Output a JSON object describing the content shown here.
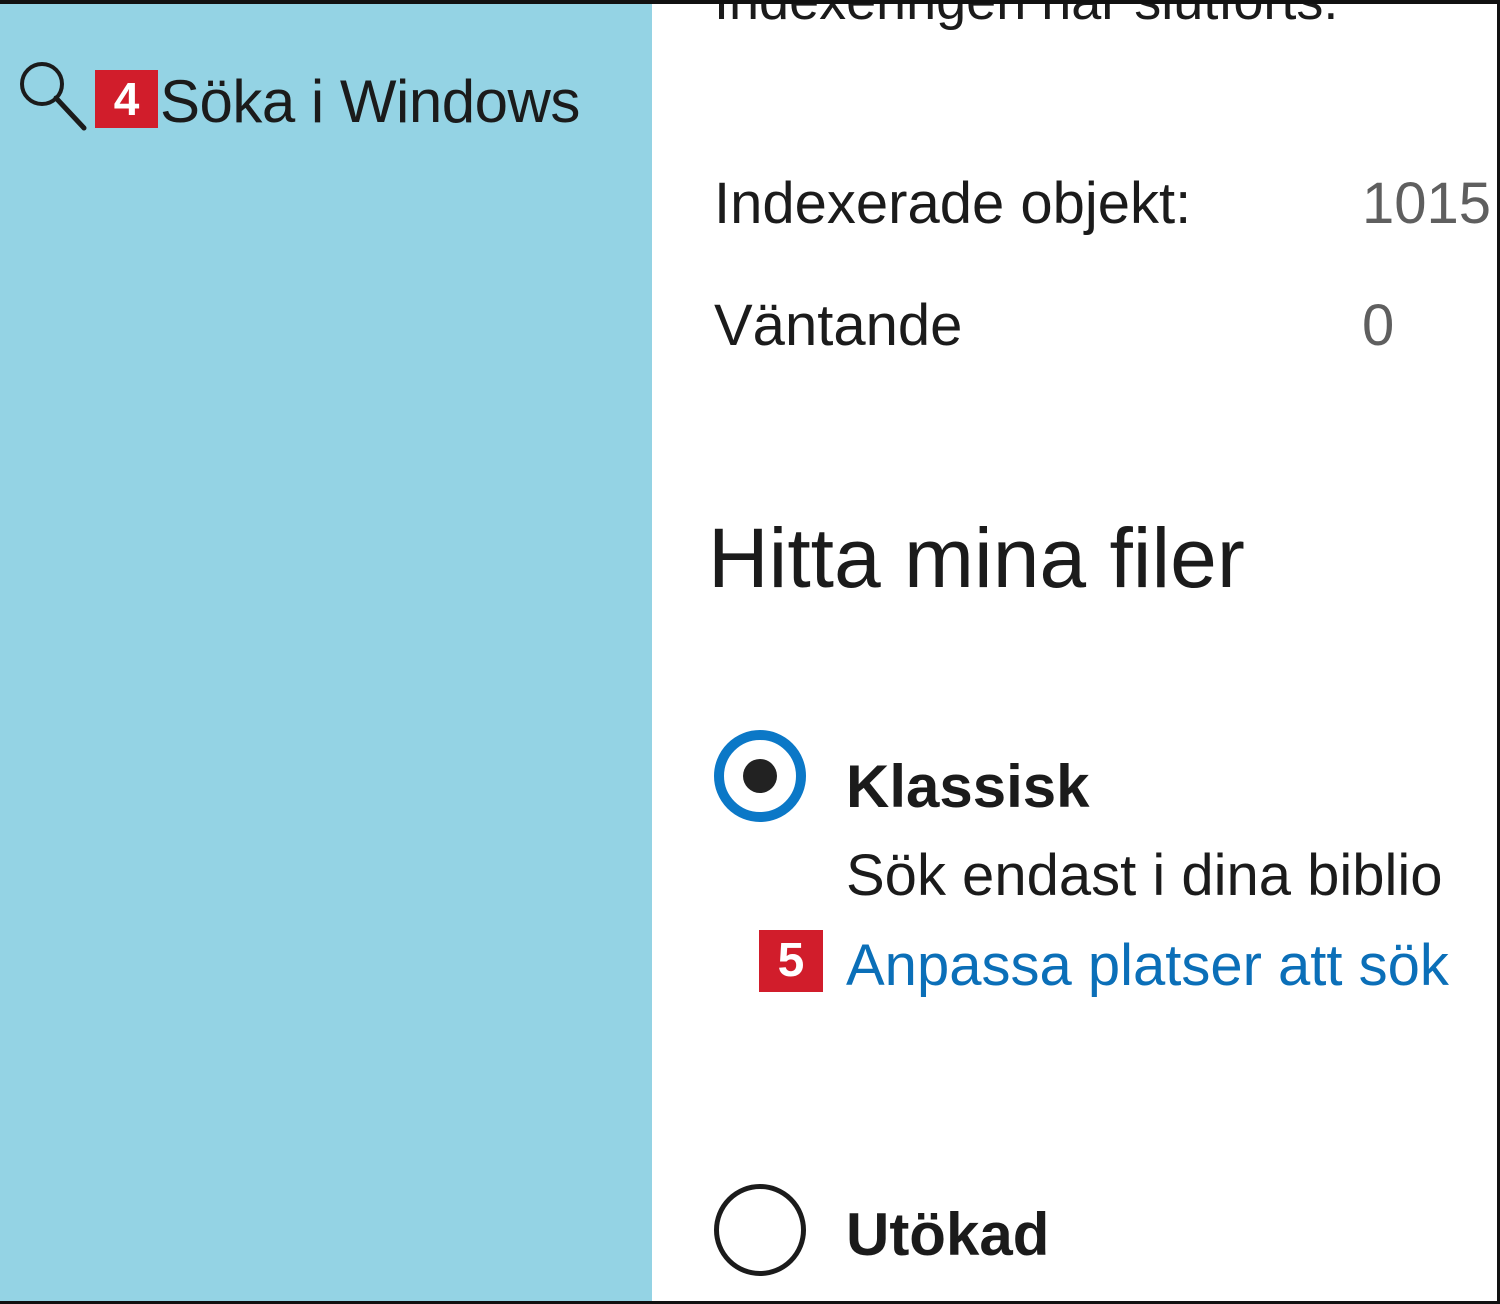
{
  "sidebar": {
    "search_icon": "search-icon",
    "search_label": "Söka i Windows",
    "step_badge": "4"
  },
  "main": {
    "status_text": "Indexeringen har slutförts.",
    "stats": [
      {
        "label": "Indexerade objekt:",
        "value": "1015"
      },
      {
        "label": "Väntande",
        "value": "0"
      }
    ],
    "section_title": "Hitta mina filer",
    "options": [
      {
        "label": "Klassisk",
        "selected": true,
        "description": "Sök endast i dina biblio",
        "link_badge": "5",
        "link": "Anpassa platser att sök"
      },
      {
        "label": "Utökad",
        "selected": false
      }
    ]
  },
  "colors": {
    "sidebar_bg": "#94d3e4",
    "badge_red": "#d11d2b",
    "accent_blue": "#0b78c7",
    "link_blue": "#0b6fb8"
  }
}
